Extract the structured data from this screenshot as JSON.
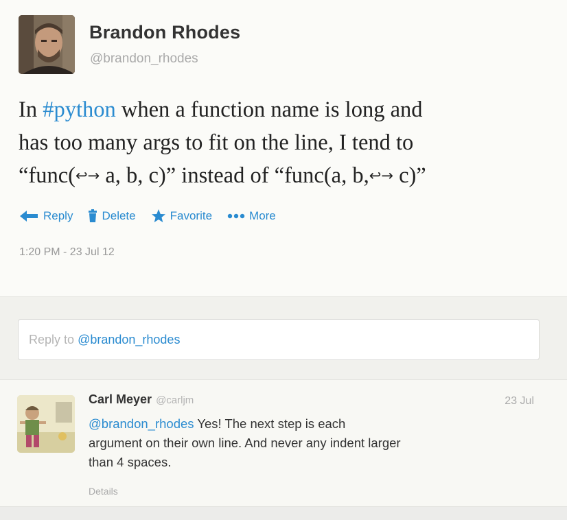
{
  "tweet": {
    "author_name": "Brandon Rhodes",
    "author_handle": "@brandon_rhodes",
    "text": {
      "line1_prefix": "In ",
      "hashtag": "#python",
      "line1_suffix": " when a function name is long and",
      "line2": "has too many args to fit on the line, I tend to",
      "line3_a": "“func(",
      "line3_b": "a, b, c)” instead of “func(a, b,",
      "line3_c": "c)”",
      "symbol": "↩→"
    },
    "timestamp": "1:20 PM - 23 Jul 12"
  },
  "actions": [
    {
      "label": "Reply",
      "icon": "reply-arrow-icon"
    },
    {
      "label": "Delete",
      "icon": "trash-icon"
    },
    {
      "label": "Favorite",
      "icon": "star-icon"
    },
    {
      "label": "More",
      "icon": "more-dots-icon"
    }
  ],
  "reply_box": {
    "prefix": "Reply to ",
    "mention": "@brandon_rhodes"
  },
  "reply": {
    "author_name": "Carl Meyer",
    "author_handle": "@carljm",
    "date": "23 Jul",
    "mention": "@brandon_rhodes",
    "line1_rest": " Yes! The next step is each",
    "line2": "argument on their own line. And never any indent larger",
    "line3": "than 4 spaces.",
    "details_label": "Details"
  },
  "colors": {
    "link": "#2a8bd0",
    "text": "#333333",
    "muted": "#aaaaaa"
  }
}
